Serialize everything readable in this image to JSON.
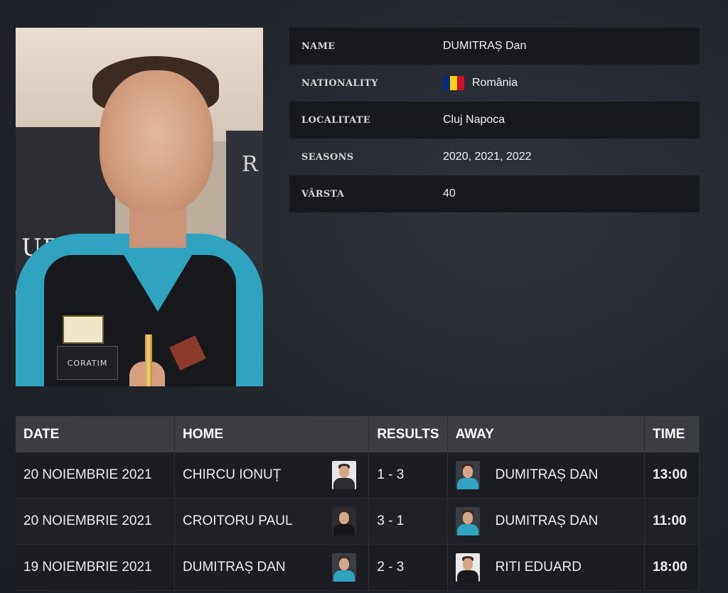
{
  "player": {
    "photo_icon": "player-portrait",
    "photo_text_left": "URY",
    "photo_text_right": "R",
    "sponsor_text": "CORATIM"
  },
  "info": [
    {
      "label": "NAME",
      "value": "DUMITRAȘ Dan"
    },
    {
      "label": "NATIONALITY",
      "value": "România",
      "flag_colors": [
        "#002B7F",
        "#FCD116",
        "#CE1126"
      ]
    },
    {
      "label": "LOCALITATE",
      "value": "Cluj Napoca"
    },
    {
      "label": "SEASONS",
      "value": "2020, 2021, 2022"
    },
    {
      "label": "VÂRSTA",
      "value": "40"
    }
  ],
  "matches": {
    "headers": {
      "date": "DATE",
      "home": "HOME",
      "results": "RESULTS",
      "away": "AWAY",
      "time": "TIME"
    },
    "rows": [
      {
        "date": "20 NOIEMBRIE 2021",
        "home": "CHIRCU IONUȚ",
        "home_avatar": "player-avatar-chircu",
        "result": "1 - 3",
        "away": "DUMITRAȘ DAN",
        "away_avatar": "player-avatar-dumitras",
        "time": "13:00"
      },
      {
        "date": "20 NOIEMBRIE 2021",
        "home": "CROITORU PAUL",
        "home_avatar": "player-avatar-croitoru",
        "result": "3 - 1",
        "away": "DUMITRAȘ DAN",
        "away_avatar": "player-avatar-dumitras",
        "time": "11:00"
      },
      {
        "date": "19 NOIEMBRIE 2021",
        "home": "DUMITRAȘ DAN",
        "home_avatar": "player-avatar-dumitras",
        "result": "2 - 3",
        "away": "RITI EDUARD",
        "away_avatar": "player-avatar-riti",
        "time": "18:00"
      }
    ]
  },
  "colors": {
    "header_bg": "#3b3d43",
    "row_bg": "#1b1d22",
    "info_row_bg": "#17191e"
  }
}
